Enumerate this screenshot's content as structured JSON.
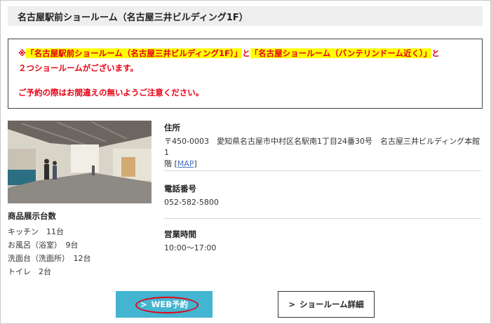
{
  "header": {
    "title": "名古屋駅前ショールーム（名古屋三井ビルディング1F）"
  },
  "notice": {
    "prefix": "※",
    "highlight1": "「名古屋駅前ショールーム（名古屋三井ビルディング1F）」",
    "connector": "と",
    "highlight2": "「名古屋ショールーム（バンテリンドーム近く）」",
    "suffix": "と",
    "line2": "２つショールームがございます。",
    "line3": "ご予約の際はお間違えの無いようご注意ください。"
  },
  "stock": {
    "title": "商品展示台数",
    "items": [
      "キッチン　11台",
      "お風呂（浴室）　9台",
      "洗面台（洗面所）　12台",
      "トイレ　2台"
    ]
  },
  "info": {
    "address_label": "住所",
    "address_line1": "〒450-0003　愛知県名古屋市中村区名駅南1丁目24番30号　名古屋三井ビルディング本館1",
    "address_line2": "階",
    "map_open": "[",
    "map_link": "MAP",
    "map_close": "]",
    "phone_label": "電話番号",
    "phone_value": "052-582-5800",
    "hours_label": "営業時間",
    "hours_value": "10:00〜17:00"
  },
  "buttons": {
    "web_icon": "chevron-right-icon",
    "web_chevron": ">",
    "web_label": "WEB予約",
    "detail_icon": "chevron-right-icon",
    "detail_chevron": ">",
    "detail_label": "ショールーム詳細"
  },
  "colors": {
    "accent": "#44b5d1",
    "alert": "#e60012",
    "highlight": "#ffff00",
    "link": "#4472c4"
  }
}
